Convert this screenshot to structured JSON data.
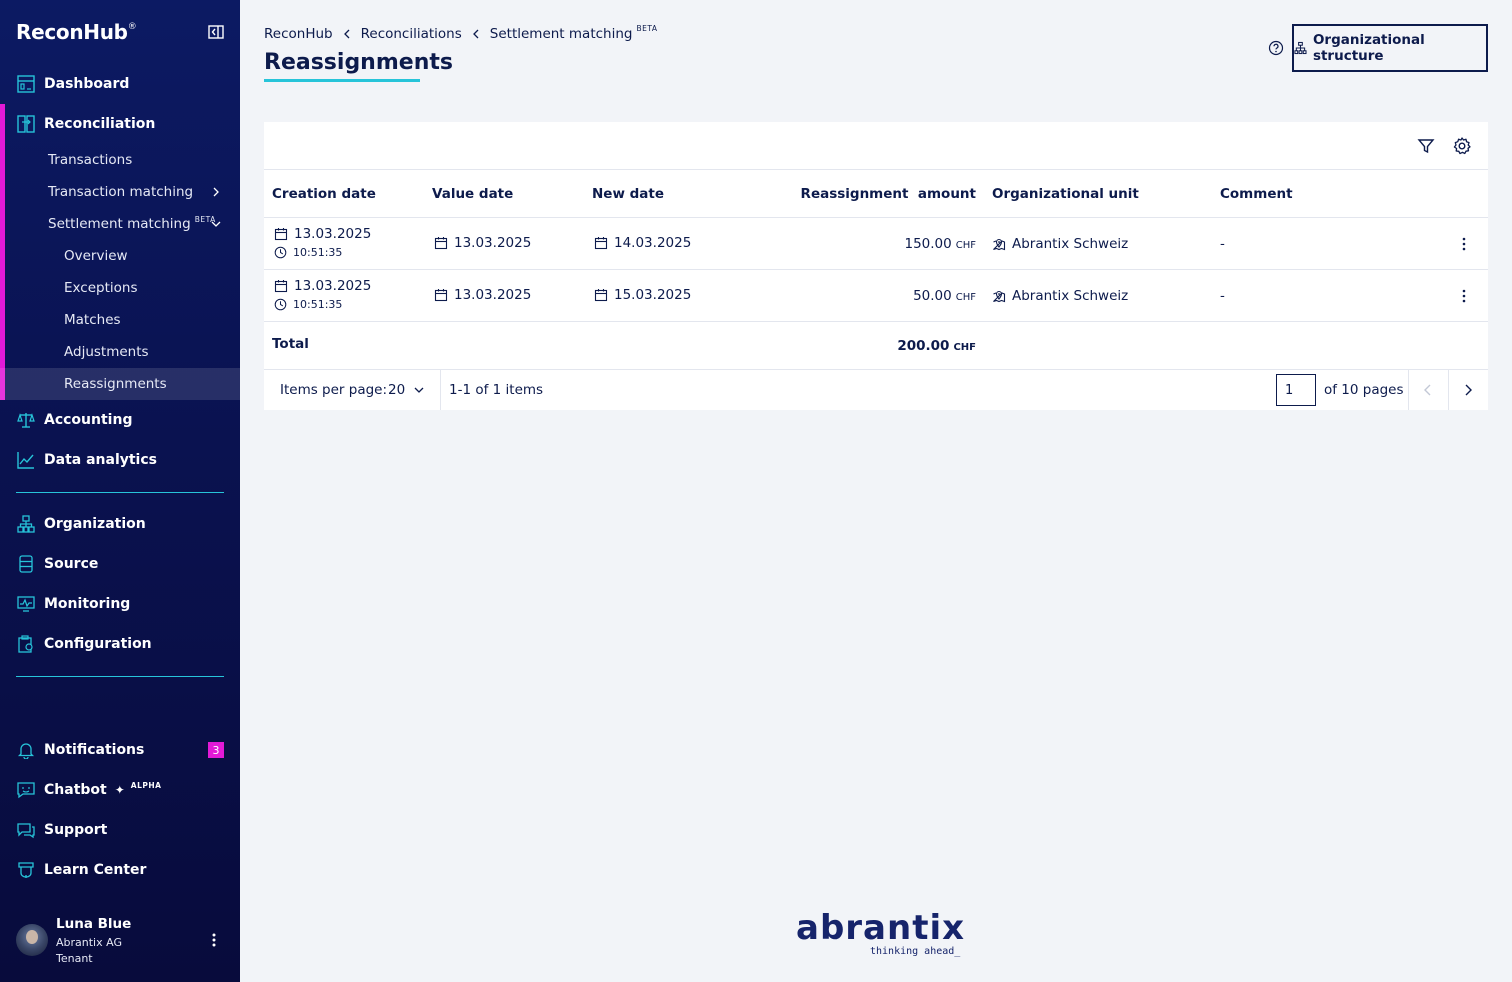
{
  "brand": {
    "name": "ReconHub",
    "reg": "®"
  },
  "sidebar": {
    "items": [
      {
        "label": "Dashboard"
      },
      {
        "label": "Reconciliation"
      },
      {
        "label": "Accounting"
      },
      {
        "label": "Data analytics"
      },
      {
        "label": "Organization"
      },
      {
        "label": "Source"
      },
      {
        "label": "Monitoring"
      },
      {
        "label": "Configuration"
      },
      {
        "label": "Notifications",
        "badge": "3"
      },
      {
        "label": "Chatbot",
        "tag": "ALPHA"
      },
      {
        "label": "Support"
      },
      {
        "label": "Learn Center"
      }
    ],
    "sub": {
      "transactions": "Transactions",
      "transaction_matching": "Transaction matching",
      "settlement_matching": "Settlement matching",
      "settlement_beta": "BETA",
      "overview": "Overview",
      "exceptions": "Exceptions",
      "matches": "Matches",
      "adjustments": "Adjustments",
      "reassignments": "Reassignments"
    },
    "user": {
      "name": "Luna Blue",
      "org": "Abrantix AG",
      "role": "Tenant"
    }
  },
  "breadcrumb": [
    "ReconHub",
    "Reconciliations",
    "Settlement matching"
  ],
  "breadcrumb_beta": "BETA",
  "page_title": "Reassignments",
  "org_button": "Organizational structure",
  "table": {
    "headers": [
      "Creation date",
      "Value date",
      "New date",
      "Reassignment  amount",
      "Organizational unit",
      "Comment"
    ],
    "rows": [
      {
        "creation_date": "13.03.2025",
        "creation_time": "10:51:35",
        "value_date": "13.03.2025",
        "new_date": "14.03.2025",
        "amount": "150.00",
        "currency": "CHF",
        "org_unit": "Abrantix Schweiz",
        "comment": "-"
      },
      {
        "creation_date": "13.03.2025",
        "creation_time": "10:51:35",
        "value_date": "13.03.2025",
        "new_date": "15.03.2025",
        "amount": "50.00",
        "currency": "CHF",
        "org_unit": "Abrantix Schweiz",
        "comment": "-"
      }
    ],
    "total_label": "Total",
    "total_amount": "200.00",
    "total_currency": "CHF"
  },
  "pager": {
    "items_per_page_label": "Items per page:",
    "items_per_page": "20",
    "range": "1-1 of 1 items",
    "page": "1",
    "of_pages": "of 10 pages"
  },
  "footer": {
    "logo": "abrantix",
    "tagline": "thinking ahead_"
  },
  "colors": {
    "sidebar": "#0c1a63",
    "accent": "#27c4d9",
    "active": "#e21ad7",
    "text": "#0d1b4c"
  }
}
